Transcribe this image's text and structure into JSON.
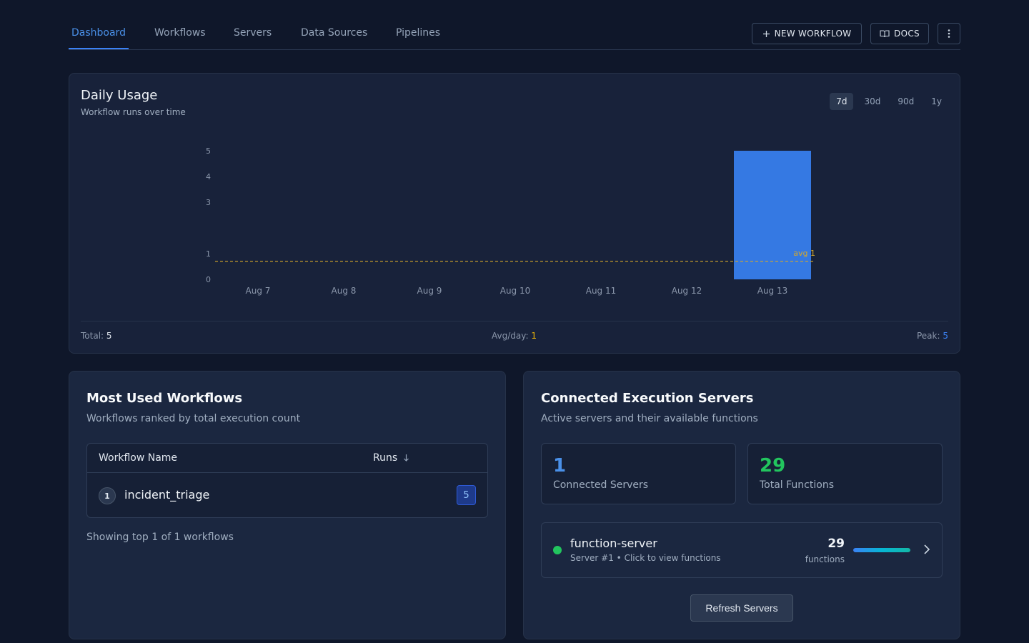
{
  "nav": {
    "tabs": [
      "Dashboard",
      "Workflows",
      "Servers",
      "Data Sources",
      "Pipelines"
    ],
    "active_tab": "Dashboard",
    "new_workflow_label": "NEW WORKFLOW",
    "docs_label": "DOCS",
    "icons": {
      "new_workflow": "plus-icon",
      "docs": "book-icon",
      "more": "more-vertical-icon"
    }
  },
  "usage": {
    "title": "Daily Usage",
    "subtitle": "Workflow runs over time",
    "ranges": [
      "7d",
      "30d",
      "90d",
      "1y"
    ],
    "active_range": "7d",
    "total_label": "Total:",
    "total_value": "5",
    "avg_label": "Avg/day:",
    "avg_value": "1",
    "peak_label": "Peak:",
    "peak_value": "5",
    "avg_line_label": "avg 1"
  },
  "chart_data": {
    "type": "bar",
    "categories": [
      "Aug 7",
      "Aug 8",
      "Aug 9",
      "Aug 10",
      "Aug 11",
      "Aug 12",
      "Aug 13"
    ],
    "values": [
      0,
      0,
      0,
      0,
      0,
      0,
      5
    ],
    "y_ticks": [
      0,
      1,
      3,
      4,
      5
    ],
    "ylim": [
      0,
      5
    ],
    "average": 0.7,
    "colors": {
      "bar": "#3579e3",
      "avg_line": "#d4a82a",
      "tick": "#8b97ab"
    }
  },
  "workflows": {
    "title": "Most Used Workflows",
    "subtitle": "Workflows ranked by total execution count",
    "columns": {
      "name": "Workflow Name",
      "runs": "Runs"
    },
    "sort_icon": "arrow-down-icon",
    "rows": [
      {
        "rank": "1",
        "name": "incident_triage",
        "runs": "5"
      }
    ],
    "footer": "Showing top 1 of 1 workflows"
  },
  "servers": {
    "title": "Connected Execution Servers",
    "subtitle": "Active servers and their available functions",
    "connected_count": "1",
    "connected_label": "Connected Servers",
    "total_functions": "29",
    "total_functions_label": "Total Functions",
    "list": [
      {
        "name": "function-server",
        "meta": "Server #1 • Click to view functions",
        "functions": "29",
        "functions_label": "functions",
        "functions_share": 1.0,
        "status": "online"
      }
    ],
    "refresh_label": "Refresh Servers",
    "colors": {
      "connected": "#4a90e8",
      "functions": "#22c55e",
      "status_online": "#22c55e"
    }
  }
}
